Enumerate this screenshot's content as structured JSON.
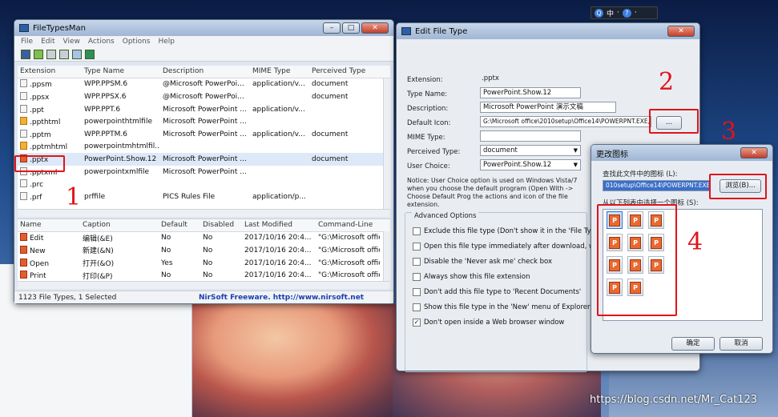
{
  "tray": {
    "items": [
      "Q",
      "中",
      "·",
      "?",
      "·"
    ]
  },
  "ftm": {
    "title": "FileTypesMan",
    "menu": [
      "File",
      "Edit",
      "View",
      "Actions",
      "Options",
      "Help"
    ],
    "columns": [
      "Extension",
      "Type Name",
      "Description",
      "MIME Type",
      "Perceived Type"
    ],
    "rows": [
      {
        "ext": ".ppsm",
        "type": "WPP.PPSM.6",
        "desc": "@Microsoft PowerPoi...",
        "mime": "application/v...",
        "perc": "document",
        "icon": "doc"
      },
      {
        "ext": ".ppsx",
        "type": "WPP.PPSX.6",
        "desc": "@Microsoft PowerPoi...",
        "mime": "",
        "perc": "document",
        "icon": "doc"
      },
      {
        "ext": ".ppt",
        "type": "WPP.PPT.6",
        "desc": "Microsoft PowerPoint ...",
        "mime": "application/v...",
        "perc": "",
        "icon": "doc"
      },
      {
        "ext": ".ppthtml",
        "type": "powerpointhtmlfile",
        "desc": "Microsoft PowerPoint ...",
        "mime": "",
        "perc": "",
        "icon": "html"
      },
      {
        "ext": ".pptm",
        "type": "WPP.PPTM.6",
        "desc": "Microsoft PowerPoint ...",
        "mime": "application/v...",
        "perc": "document",
        "icon": "doc"
      },
      {
        "ext": ".pptmhtml",
        "type": "powerpointmhtmlfil...",
        "desc": "",
        "mime": "",
        "perc": "",
        "icon": "html"
      },
      {
        "ext": ".pptx",
        "type": "PowerPoint.Show.12",
        "desc": "Microsoft PowerPoint ...",
        "mime": "",
        "perc": "document",
        "icon": "ppt"
      },
      {
        "ext": ".pptxml",
        "type": "powerpointxmlfile",
        "desc": "Microsoft PowerPoint ...",
        "mime": "",
        "perc": "",
        "icon": "doc"
      },
      {
        "ext": ".prc",
        "type": "",
        "desc": "",
        "mime": "",
        "perc": "",
        "icon": "doc"
      },
      {
        "ext": ".prf",
        "type": "prffile",
        "desc": "PICS Rules File",
        "mime": "application/p...",
        "perc": "",
        "icon": "doc"
      }
    ],
    "action_columns": [
      "Name",
      "Caption",
      "Default",
      "Disabled",
      "Last Modified",
      "Command-Line"
    ],
    "actions": [
      {
        "name": "Edit",
        "caption": "编辑(&E)",
        "def": "No",
        "dis": "No",
        "mod": "2017/10/16 20:4...",
        "cmd": "\"G:\\Microsoft offic"
      },
      {
        "name": "New",
        "caption": "新建(&N)",
        "def": "No",
        "dis": "No",
        "mod": "2017/10/16 20:4...",
        "cmd": "\"G:\\Microsoft offic"
      },
      {
        "name": "Open",
        "caption": "打开(&O)",
        "def": "Yes",
        "dis": "No",
        "mod": "2017/10/16 20:4...",
        "cmd": "\"G:\\Microsoft offic"
      },
      {
        "name": "Print",
        "caption": "打印(&P)",
        "def": "No",
        "dis": "No",
        "mod": "2017/10/16 20:4...",
        "cmd": "\"G:\\Microsoft offic"
      }
    ],
    "status": "1123 File Types, 1 Selected",
    "status_link": "NirSoft Freeware.  http://www.nirsoft.net"
  },
  "eft": {
    "title": "Edit File Type",
    "labels": {
      "extension": "Extension:",
      "type_name": "Type Name:",
      "description": "Description:",
      "default_icon": "Default Icon:",
      "mime": "MIME Type:",
      "perceived": "Perceived Type:",
      "user_choice": "User Choice:"
    },
    "values": {
      "extension": ".pptx",
      "type_name": "PowerPoint.Show.12",
      "description": "Microsoft PowerPoint 演示文稿",
      "default_icon": "G:\\Microsoft office\\2010setup\\Office14\\POWERPNT.EXE,-",
      "mime": "",
      "perceived": "document",
      "user_choice": "PowerPoint.Show.12"
    },
    "browse_label": "...",
    "notice": "Notice: User Choice option is used on Windows Vista/7 when you choose the default program (Open With -> Choose Default Prog the actions and icon of the file extension.",
    "advanced_title": "Advanced Options",
    "options": [
      {
        "label": "Exclude  this file type (Don't show it in the 'File Types' optio",
        "checked": false
      },
      {
        "label": "Open this file type immediately after download, without co",
        "checked": false
      },
      {
        "label": "Disable the 'Never ask me' check box",
        "checked": false
      },
      {
        "label": "Always show this file extension",
        "checked": false
      },
      {
        "label": "Don't add this file type to 'Recent Documents'",
        "checked": false
      },
      {
        "label": "Show this file type in the 'New' menu of Explorer",
        "checked": false
      },
      {
        "label": "Don't open inside a Web browser window",
        "checked": true
      }
    ]
  },
  "ci": {
    "title": "更改图标",
    "search_label": "查找此文件中的图标 (L):",
    "path": "010setup\\Office14\\POWERPNT.EXE",
    "browse": "浏览(B)...",
    "list_label": "从以下列表中选择一个图标 (S):",
    "ok": "确定",
    "cancel": "取消"
  },
  "annotations": [
    "1",
    "2",
    "3",
    "4"
  ],
  "watermark": "https://blog.csdn.net/Mr_Cat123"
}
